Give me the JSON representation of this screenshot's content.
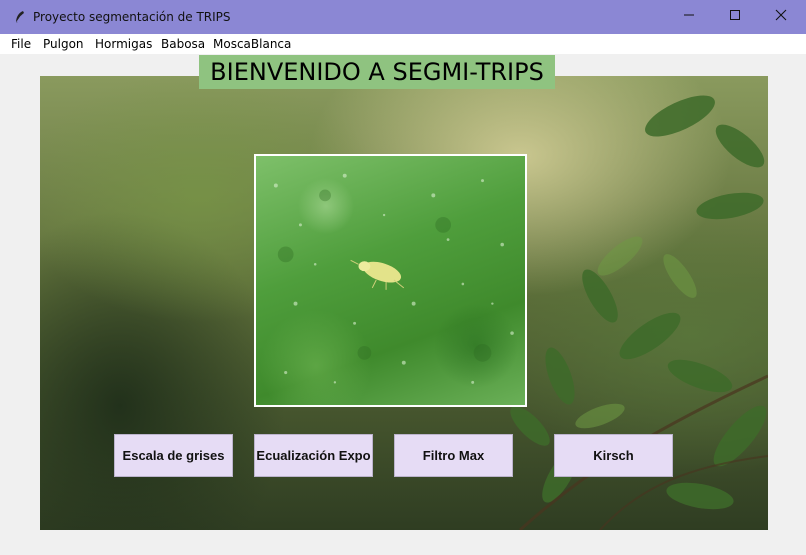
{
  "window": {
    "title": "Proyecto segmentación de TRIPS",
    "title_icon": "feather-icon",
    "controls": [
      "minimize-icon",
      "maximize-icon",
      "close-icon"
    ]
  },
  "menu": {
    "items": [
      "File",
      "Pulgon",
      "Hormigas",
      "Babosa",
      "MoscaBlanca"
    ]
  },
  "banner": {
    "text": "BIENVENIDO A SEGMI-TRIPS",
    "color": "#8fc380"
  },
  "image": {
    "subject": "thrips-on-leaf-photo"
  },
  "buttons": [
    {
      "label": "Escala de grises"
    },
    {
      "label": "Ecualización Expo"
    },
    {
      "label": "Filtro Max"
    },
    {
      "label": "Kirsch"
    }
  ],
  "colors": {
    "titlebar": "#8b87d4",
    "button_bg": "#e6dcf5"
  }
}
